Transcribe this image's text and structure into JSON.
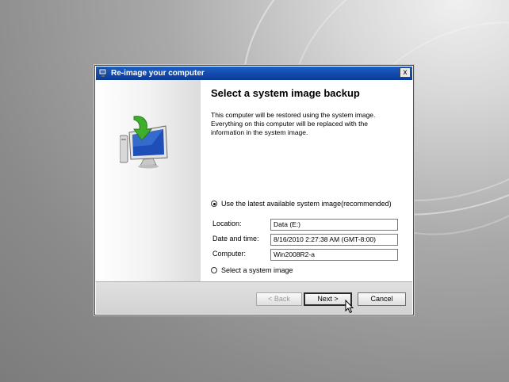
{
  "window": {
    "title": "Re-image your computer",
    "close_label": "x"
  },
  "main": {
    "heading": "Select a system image backup",
    "description": "This computer will be restored using the system image. Everything on this computer will be replaced with the information in the system image.",
    "option_latest": {
      "label": "Use the latest available system image(recommended)",
      "selected": true
    },
    "fields": [
      {
        "label": "Location:",
        "value": "Data (E:)"
      },
      {
        "label": "Date and time:",
        "value": "8/16/2010 2:27:38 AM (GMT-8:00)"
      },
      {
        "label": "Computer:",
        "value": "Win2008R2-a"
      }
    ],
    "option_select": {
      "label": "Select a system image",
      "selected": false
    }
  },
  "footer": {
    "back_label": "< Back",
    "next_label": "Next >",
    "cancel_label": "Cancel"
  },
  "icons": [
    "computer-restore-icon",
    "window-app-icon",
    "mouse-cursor-icon"
  ],
  "colors": {
    "titlebar": "#0a3a9a",
    "arrow": "#3fae2a",
    "screen": "#1e4fb8"
  }
}
